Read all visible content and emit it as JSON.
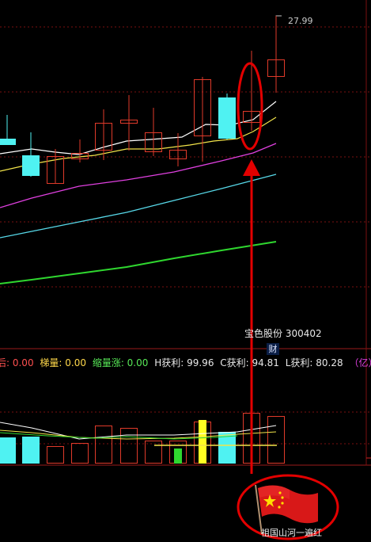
{
  "colors": {
    "background": "#000000",
    "grid": "#7a1010",
    "candle_up": "#e03a2a",
    "candle_down": "#4ff2f2",
    "ma5": "#ffffff",
    "ma10": "#f2e44a",
    "ma20": "#e040e0",
    "ma60": "#57d8e8",
    "ma120": "#2fd72f",
    "annotation": "#e30000"
  },
  "price_label": "27.99",
  "stock_label": "宝色股份 300402",
  "badge": "财",
  "info_row": [
    {
      "text": "后: 0.00",
      "color": "#ff5050"
    },
    {
      "text": "梯量: 0.00",
      "color": "#ffd84a"
    },
    {
      "text": "缩量涨: 0.00",
      "color": "#57e857"
    },
    {
      "text": "H获利: 99.96",
      "color": "#e8e8e8"
    },
    {
      "text": "C获利: 94.81",
      "color": "#e8e8e8"
    },
    {
      "text": "L获利: 80.28",
      "color": "#e8e8e8"
    },
    {
      "text": "（亿）获利筹",
      "color": "#e040e0"
    }
  ],
  "flag_caption": "祖国山河一遍红",
  "icons": {
    "flag": "china-flag-icon"
  }
}
